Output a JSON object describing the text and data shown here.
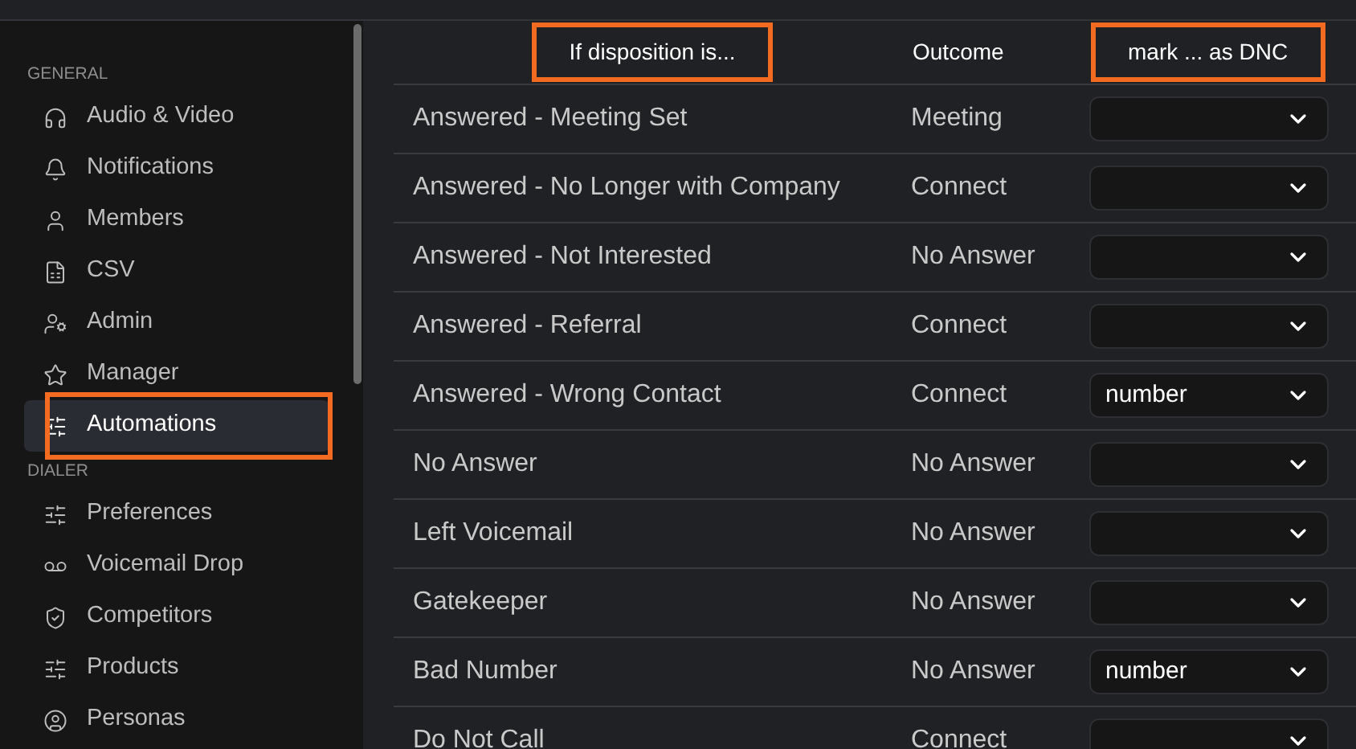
{
  "sidebar": {
    "sections": [
      {
        "title": "GENERAL",
        "items": [
          {
            "label": "Audio & Video",
            "kind": "headphones",
            "selected": false,
            "highlighted": false
          },
          {
            "label": "Notifications",
            "kind": "bell",
            "selected": false,
            "highlighted": false
          },
          {
            "label": "Members",
            "kind": "user",
            "selected": false,
            "highlighted": false
          },
          {
            "label": "CSV",
            "kind": "csv",
            "selected": false,
            "highlighted": false
          },
          {
            "label": "Admin",
            "kind": "admin",
            "selected": false,
            "highlighted": false
          },
          {
            "label": "Manager",
            "kind": "star",
            "selected": false,
            "highlighted": false
          },
          {
            "label": "Automations",
            "kind": "sliders",
            "selected": true,
            "highlighted": true
          }
        ]
      },
      {
        "title": "DIALER",
        "items": [
          {
            "label": "Preferences",
            "kind": "sliders",
            "selected": false,
            "highlighted": false
          },
          {
            "label": "Voicemail Drop",
            "kind": "voicemail",
            "selected": false,
            "highlighted": false
          },
          {
            "label": "Competitors",
            "kind": "competitors",
            "selected": false,
            "highlighted": false
          },
          {
            "label": "Products",
            "kind": "sliders",
            "selected": false,
            "highlighted": false
          },
          {
            "label": "Personas",
            "kind": "persona",
            "selected": false,
            "highlighted": false
          }
        ]
      }
    ]
  },
  "table": {
    "columns": [
      {
        "label": "If disposition is...",
        "highlighted": true
      },
      {
        "label": "Outcome",
        "highlighted": false
      },
      {
        "label": "mark ... as DNC",
        "highlighted": true
      }
    ],
    "rows": [
      {
        "disposition": "Answered - Meeting Set",
        "outcome": "Meeting"
      },
      {
        "disposition": "Answered - No Longer with Company",
        "outcome": "Connect"
      },
      {
        "disposition": "Answered - Not Interested",
        "outcome": "No Answer"
      },
      {
        "disposition": "Answered - Referral",
        "outcome": "Connect"
      },
      {
        "disposition": "Answered - Wrong Contact",
        "outcome": "Connect",
        "dnc": "number"
      },
      {
        "disposition": "No Answer",
        "outcome": "No Answer"
      },
      {
        "disposition": "Left Voicemail",
        "outcome": "No Answer"
      },
      {
        "disposition": "Gatekeeper",
        "outcome": "No Answer"
      },
      {
        "disposition": "Bad Number",
        "outcome": "No Answer",
        "dnc": "number"
      },
      {
        "disposition": "Do Not Call",
        "outcome": "Connect"
      }
    ]
  }
}
